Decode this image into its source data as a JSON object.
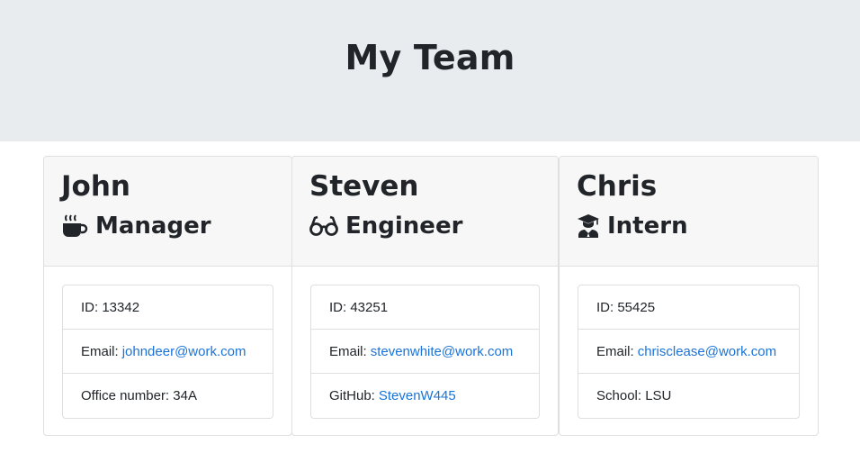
{
  "header": {
    "title": "My Team"
  },
  "team": [
    {
      "name": "John",
      "role": "Manager",
      "icon": "coffee-icon",
      "id_label": "ID: 13342",
      "email_label": "Email:",
      "email": "johndeer@work.com",
      "extra_label": "Office number: 34A"
    },
    {
      "name": "Steven",
      "role": "Engineer",
      "icon": "glasses-icon",
      "id_label": "ID: 43251",
      "email_label": "Email:",
      "email": "stevenwhite@work.com",
      "extra_label": "GitHub:",
      "extra_link": "StevenW445"
    },
    {
      "name": "Chris",
      "role": "Intern",
      "icon": "graduate-icon",
      "id_label": "ID: 55425",
      "email_label": "Email:",
      "email": "chrisclease@work.com",
      "extra_label": "School: LSU"
    }
  ],
  "colors": {
    "link": "#1a73d9",
    "header_bg": "#e9ecef",
    "card_header_bg": "#f7f7f7"
  }
}
